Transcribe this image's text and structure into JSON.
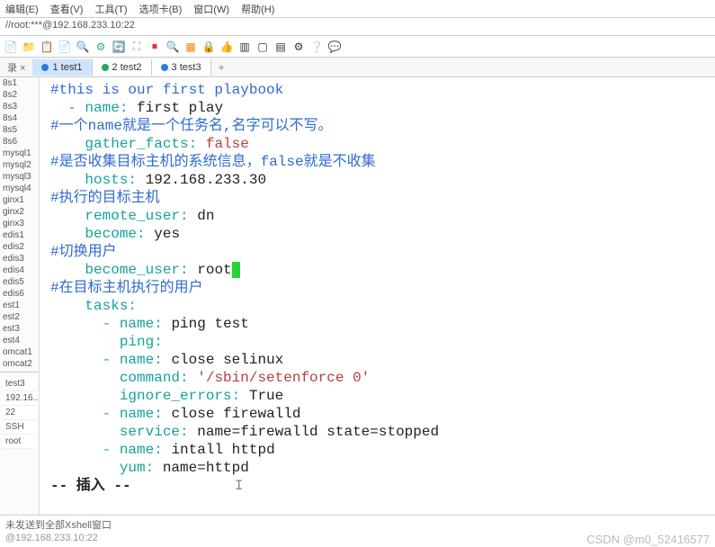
{
  "menu": {
    "edit": "编辑(E)",
    "view": "查看(V)",
    "tools": "工具(T)",
    "tabs": "选项卡(B)",
    "window": "窗口(W)",
    "help": "帮助(H)"
  },
  "address": "//root:***@192.168.233.10:22",
  "tabs": {
    "leading": "录 ×",
    "t1": "1 test1",
    "t2": "2 test2",
    "t3": "3 test3",
    "add": "+"
  },
  "side": {
    "items": [
      "8s1",
      "8s2",
      "8s3",
      "8s4",
      "8s5",
      "8s6",
      "mysql1",
      "mysql2",
      "mysql3",
      "mysql4",
      "ginx1",
      "ginx2",
      "ginx3",
      "edis1",
      "edis2",
      "edis3",
      "edis4",
      "edis5",
      "edis6",
      "est1",
      "est2",
      "est3",
      "est4",
      "omcat1",
      "omcat2"
    ],
    "info": [
      "test3",
      "192.16...",
      "22",
      "SSH",
      "root"
    ]
  },
  "code": {
    "l1": "#this is our first playbook",
    "l2a": "name:",
    "l2b": "first play",
    "l3": "#一个name就是一个任务名,名字可以不写。",
    "l4a": "gather_facts:",
    "l4b": "false",
    "l5": "#是否收集目标主机的系统信息，false就是不收集",
    "l6a": "hosts:",
    "l6b": "192.168.233.30",
    "l7": "#执行的目标主机",
    "l8a": "remote_user:",
    "l8b": "dn",
    "l9a": "become:",
    "l9b": "yes",
    "l10": "#切换用户",
    "l11a": "become_user:",
    "l11b": "root",
    "l12": "#在目标主机执行的用户",
    "l13": "tasks:",
    "l14a": "name:",
    "l14b": "ping test",
    "l15": "ping:",
    "l16a": "name:",
    "l16b": "close selinux",
    "l17a": "command:",
    "l17b": "'/sbin/setenforce 0'",
    "l18a": "ignore_errors:",
    "l18b": "True",
    "l19a": "name:",
    "l19b": "close firewalld",
    "l20a": "service:",
    "l20b": "name=firewalld state=stopped",
    "l21a": "name:",
    "l21b": "intall httpd",
    "l22a": "yum:",
    "l22b": "name=httpd",
    "mode": "-- 插入 --"
  },
  "status": "未发送到全部Xshell窗口",
  "footer": {
    "left": "@192.168.233.10:22",
    "right": "CSDN @m0_52416577"
  },
  "cursor_block": " "
}
